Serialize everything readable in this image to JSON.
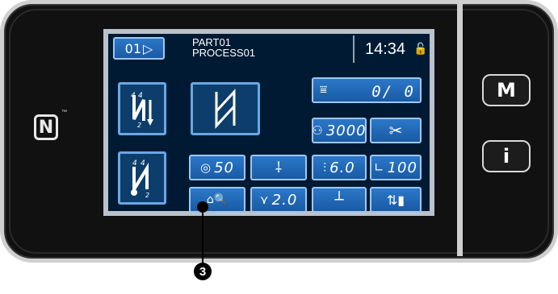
{
  "header": {
    "pattern_no": "01",
    "part_name": "PART01",
    "process_name": "PROCESS01",
    "time": "14:34"
  },
  "counter": {
    "value": "0/   0"
  },
  "buttons": {
    "thread_tension_value": "50",
    "bobbin_value": "3000",
    "stitch_length_value": "6.0",
    "presser_value": "100",
    "feed_value": "2.0"
  },
  "side": {
    "menu_label": "M",
    "info_label": "i"
  },
  "nfc_label": "N",
  "callout": {
    "number": "3"
  },
  "colors": {
    "screen_bg": "#001a33",
    "button": "#2b78c8",
    "button_border": "#9fc7f2",
    "bezel": "#111111"
  }
}
